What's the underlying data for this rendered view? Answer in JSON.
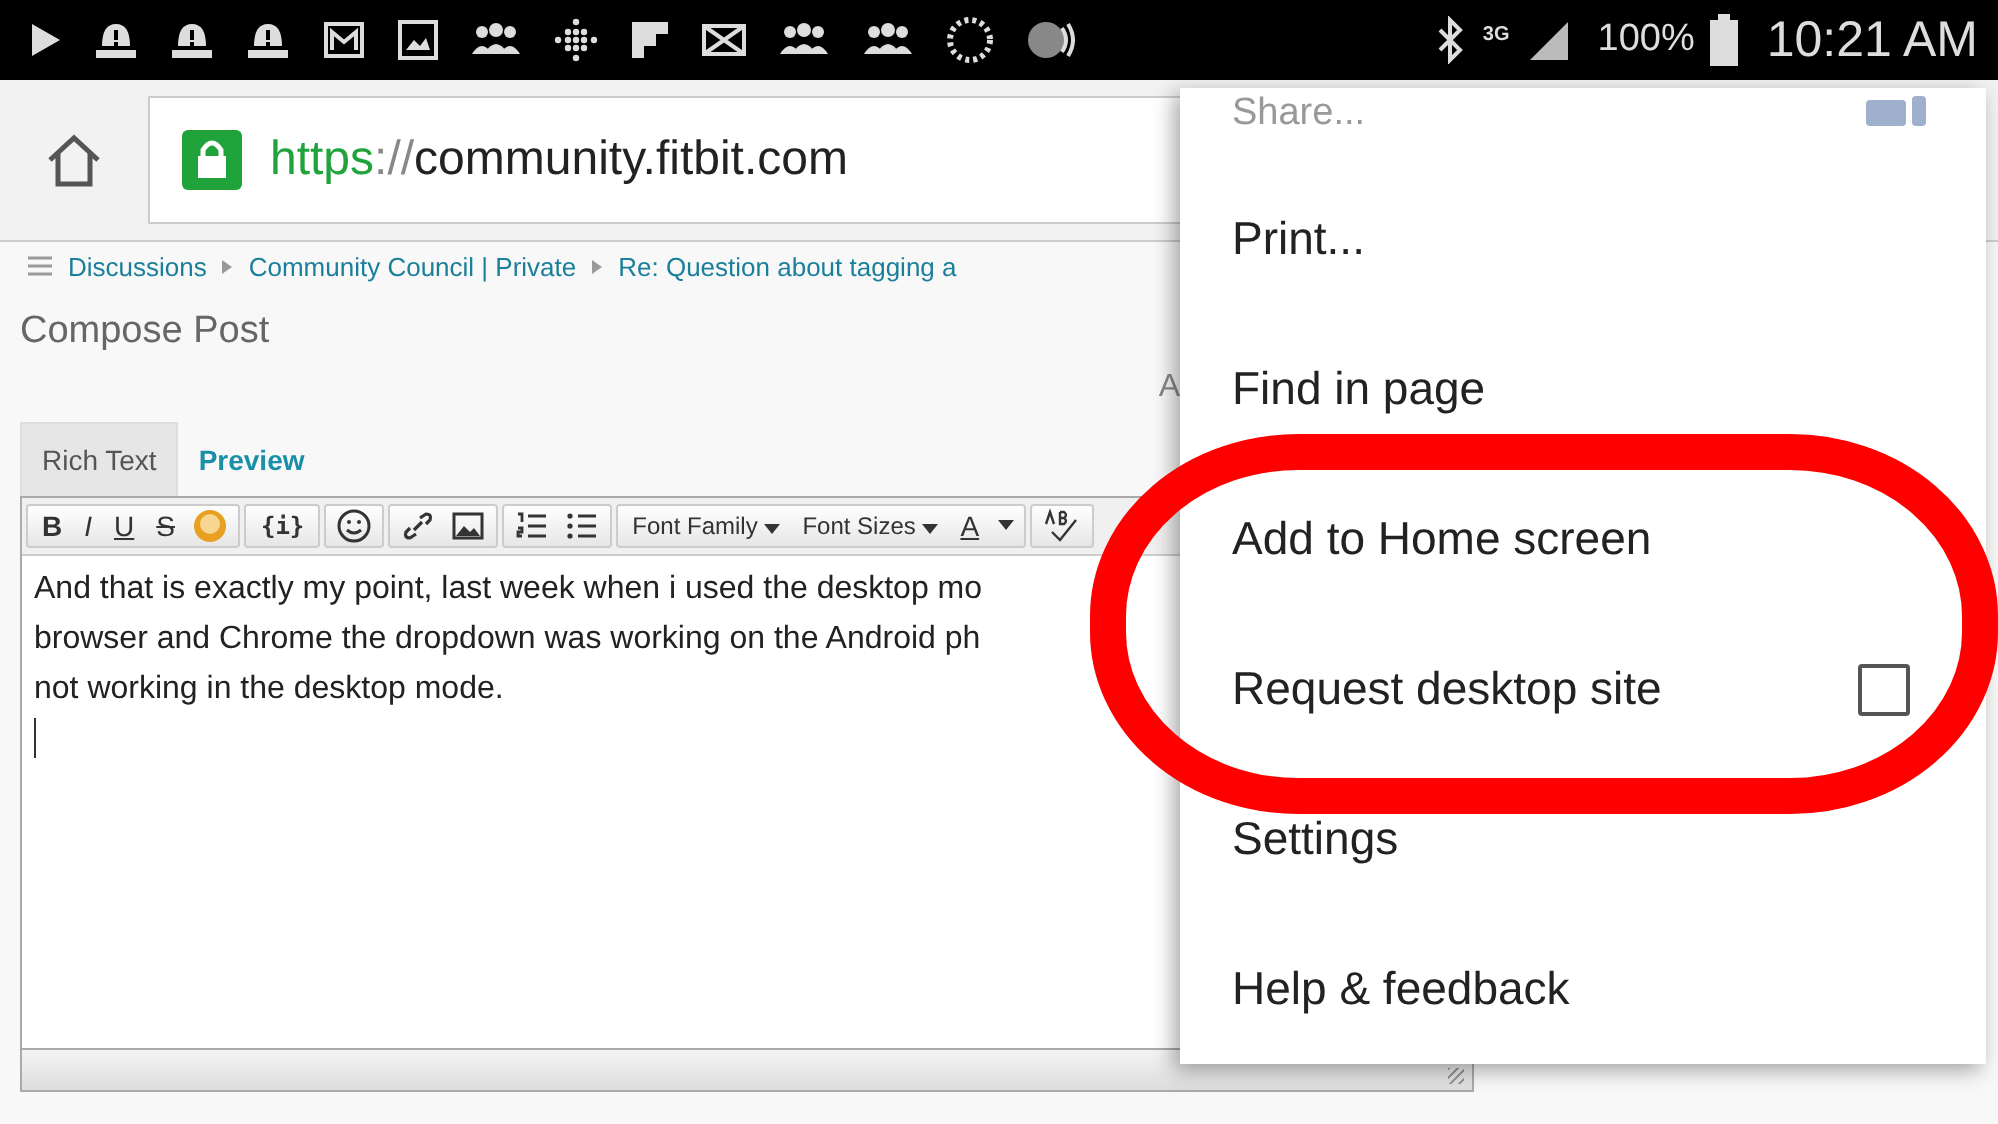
{
  "status_bar": {
    "network": "3G",
    "battery": "100%",
    "time": "10:21 AM"
  },
  "address_bar": {
    "scheme": "https",
    "separator": "://",
    "host": "community.fitbit.com"
  },
  "breadcrumb": [
    "Discussions",
    "Community Council | Private",
    "Re: Question about tagging a"
  ],
  "compose": {
    "title": "Compose Post",
    "right_label": "A"
  },
  "tabs": [
    {
      "label": "Rich Text",
      "selected": true
    },
    {
      "label": "Preview",
      "selected": false
    }
  ],
  "toolbar": {
    "format_buttons": [
      "B",
      "I",
      "U",
      "S"
    ],
    "code_button": "{i}",
    "dropdowns": [
      "Font Family",
      "Font Sizes"
    ],
    "color_button": "A"
  },
  "editor": {
    "lines": [
      "And that is exactly my point, last week when i used the desktop mo",
      "browser and Chrome the dropdown was working on the Android ph",
      "not working in the desktop mode."
    ]
  },
  "menu": {
    "items": [
      {
        "label": "Share...",
        "kind": "share"
      },
      {
        "label": "Print...",
        "kind": "text"
      },
      {
        "label": "Find in page",
        "kind": "text"
      },
      {
        "label": "Add to Home screen",
        "kind": "text"
      },
      {
        "label": "Request desktop site",
        "kind": "checkbox",
        "checked": false
      },
      {
        "label": "Settings",
        "kind": "text"
      },
      {
        "label": "Help & feedback",
        "kind": "text"
      }
    ]
  }
}
